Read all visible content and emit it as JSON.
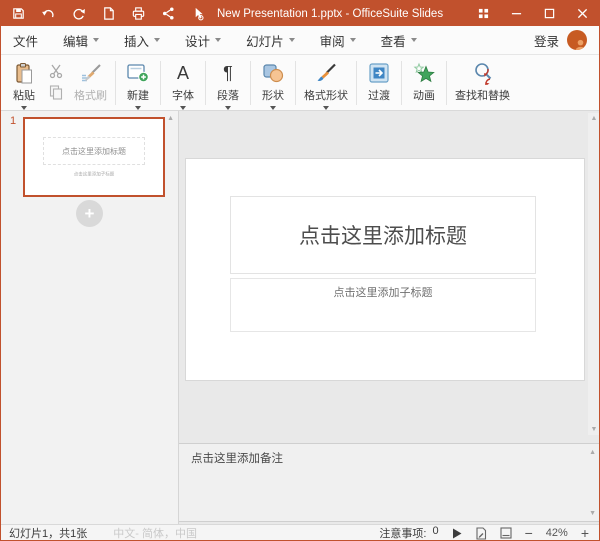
{
  "window": {
    "title": "New Presentation 1.pptx - OfficeSuite Slides",
    "titlebar_icons": [
      "save-icon",
      "undo-icon",
      "redo-icon",
      "new-document-icon",
      "print-icon",
      "share-icon",
      "presenter-pointer-icon"
    ],
    "window_controls": [
      "expand-icon",
      "minimize-icon",
      "maximize-icon",
      "close-icon"
    ]
  },
  "menu": {
    "items": [
      {
        "label": "文件",
        "has_dropdown": false
      },
      {
        "label": "编辑",
        "has_dropdown": true
      },
      {
        "label": "插入",
        "has_dropdown": true
      },
      {
        "label": "设计",
        "has_dropdown": true
      },
      {
        "label": "幻灯片",
        "has_dropdown": true
      },
      {
        "label": "审阅",
        "has_dropdown": true
      },
      {
        "label": "查看",
        "has_dropdown": true
      }
    ],
    "login_label": "登录"
  },
  "toolbar": {
    "paste_label": "粘贴",
    "format_painter_label": "格式刷",
    "new_slide_label": "新建",
    "font_label": "字体",
    "font_glyph": "A",
    "paragraph_label": "段落",
    "paragraph_glyph": "¶",
    "shapes_label": "形状",
    "format_shape_label": "格式形状",
    "transition_label": "过渡",
    "animation_label": "动画",
    "find_replace_label": "查找和替换",
    "icons": [
      "paste-clipboard-icon",
      "cut-scissors-icon",
      "copy-icon",
      "format-painter-brush-icon",
      "new-slide-plus-icon",
      "font-letter-icon",
      "paragraph-mark-icon",
      "shapes-icon",
      "format-shape-brush-icon",
      "transition-arrow-icon",
      "animation-star-icon",
      "find-replace-magnifier-icon",
      "collapse-ribbon-chevron-icon"
    ]
  },
  "slides_panel": {
    "slide_number": "1",
    "thumbnail_title": "点击这里添加标题",
    "thumbnail_subtitle": "点击这里添加子标题",
    "add_slide_glyph": "+"
  },
  "slide": {
    "title_placeholder": "点击这里添加标题",
    "subtitle_placeholder": "点击这里添加子标题"
  },
  "notes": {
    "placeholder": "点击这里添加备注"
  },
  "status_bar": {
    "slide_info": "幻灯片1，共1张",
    "language_info": "中文- 简体，中国",
    "issues_label": "注意事项:",
    "issues_count": "0",
    "zoom_out": "−",
    "zoom_level": "42%",
    "zoom_in": "+",
    "icons": [
      "play-slideshow-icon",
      "edit-view-icon",
      "notes-view-icon"
    ]
  },
  "colors": {
    "titlebar": "#c1512d",
    "accent": "#c1512d",
    "toolbar_bg": "#fbfbfb",
    "canvas_bg": "#e9e9e9",
    "panel_bg": "#f2f2f2",
    "green": "#3fa45b",
    "blue": "#3f86c4"
  },
  "scroll": {
    "up_glyph": "▲",
    "down_glyph": "▼"
  }
}
